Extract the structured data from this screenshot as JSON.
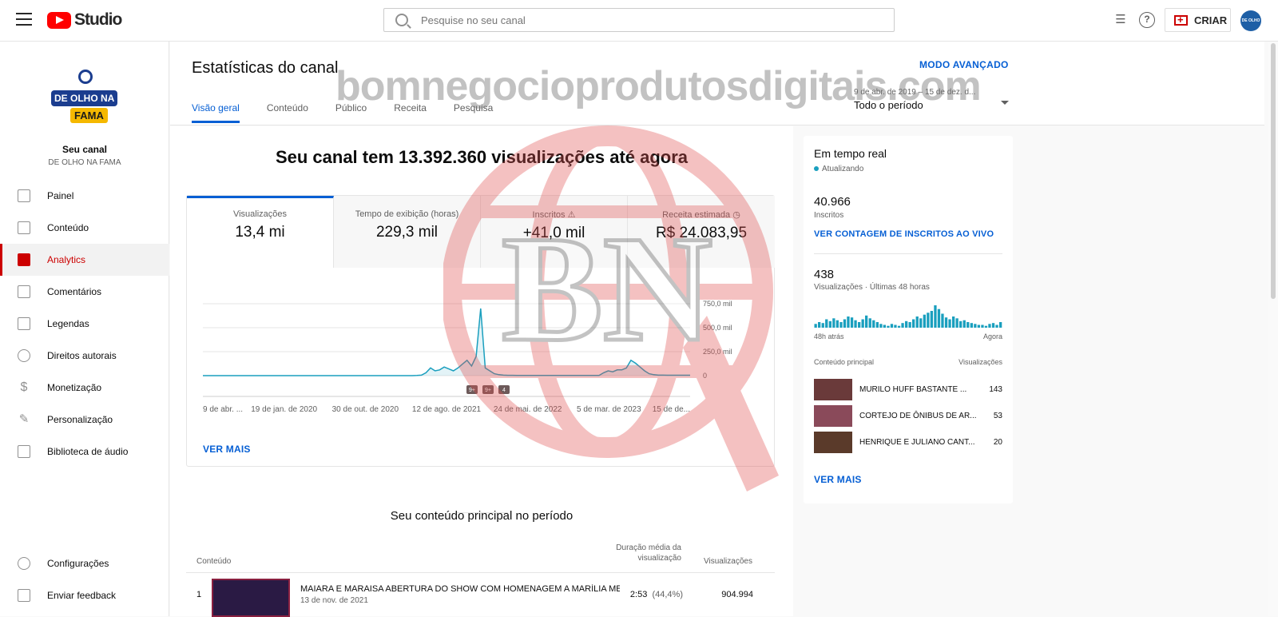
{
  "topbar": {
    "logo_text": "Studio",
    "search_placeholder": "Pesquise no seu canal",
    "create_label": "CRIAR",
    "avatar_text": "DE OLHO NA FAMA"
  },
  "sidebar": {
    "channel_logo_line1": "DE OLHO NA",
    "channel_logo_line2": "FAMA",
    "your_channel": "Seu canal",
    "channel_name": "DE OLHO NA FAMA",
    "items": [
      {
        "label": "Painel",
        "icon": "dashboard-icon"
      },
      {
        "label": "Conteúdo",
        "icon": "content-icon"
      },
      {
        "label": "Analytics",
        "icon": "analytics-icon"
      },
      {
        "label": "Comentários",
        "icon": "comments-icon"
      },
      {
        "label": "Legendas",
        "icon": "subtitles-icon"
      },
      {
        "label": "Direitos autorais",
        "icon": "copyright-icon"
      },
      {
        "label": "Monetização",
        "icon": "monetization-icon"
      },
      {
        "label": "Personalização",
        "icon": "customization-icon"
      },
      {
        "label": "Biblioteca de áudio",
        "icon": "audio-library-icon"
      }
    ],
    "bottom_items": [
      {
        "label": "Configurações",
        "icon": "gear-icon"
      },
      {
        "label": "Enviar feedback",
        "icon": "feedback-icon"
      }
    ]
  },
  "header": {
    "title": "Estatísticas do canal",
    "advanced_mode": "MODO AVANÇADO",
    "tabs": [
      "Visão geral",
      "Conteúdo",
      "Público",
      "Receita",
      "Pesquisa"
    ],
    "period_range": "9 de abr. de 2019 – 15 de dez. d...",
    "period_selected": "Todo o período"
  },
  "overview": {
    "headline": "Seu canal tem 13.392.360 visualizações até agora",
    "metrics": [
      {
        "label": "Visualizações",
        "value": "13,4 mi"
      },
      {
        "label": "Tempo de exibição (horas)",
        "value": "229,3 mil"
      },
      {
        "label": "Inscritos",
        "value": "+41,0 mil"
      },
      {
        "label": "Receita estimada",
        "value": "R$ 24.083,95"
      }
    ],
    "see_more": "VER MAIS"
  },
  "chart_data": {
    "type": "line",
    "x_tick_labels": [
      "9 de abr. ...",
      "19 de jan. de 2020",
      "30 de out. de 2020",
      "12 de ago. de 2021",
      "24 de mai. de 2022",
      "5 de mar. de 2023",
      "15 de de..."
    ],
    "y_tick_labels": [
      "750,0 mil",
      "500,0 mil",
      "250,0 mil",
      "0"
    ],
    "ylim": [
      0,
      750000
    ],
    "series": [
      {
        "values": [
          0,
          0,
          0,
          0,
          0,
          0,
          0,
          0,
          0,
          0,
          0,
          0,
          0,
          0,
          0,
          0,
          0,
          0,
          0,
          0,
          0,
          0,
          0,
          0,
          0,
          0,
          0,
          0,
          0,
          0,
          0,
          0,
          0,
          0,
          0,
          0,
          0,
          0,
          0,
          0,
          0,
          0,
          0,
          0,
          0,
          0,
          0,
          2000,
          5000,
          30000,
          80000,
          50000,
          60000,
          90000,
          70000,
          50000,
          80000,
          120000,
          160000,
          100000,
          200000,
          700000,
          80000,
          50000,
          20000,
          10000,
          5000,
          3000,
          3000,
          2000,
          2000,
          2000,
          2000,
          2000,
          2000,
          2000,
          2000,
          2000,
          2000,
          2000,
          2000,
          2000,
          2000,
          2000,
          2000,
          2000,
          2000,
          2000,
          30000,
          50000,
          40000,
          60000,
          60000,
          80000,
          160000,
          130000,
          90000,
          50000,
          20000,
          10000,
          5000,
          5000,
          4000,
          4000,
          4000,
          4000,
          4000,
          4000
        ]
      }
    ],
    "markers": [
      "9+",
      "9+",
      "4"
    ]
  },
  "top_content": {
    "title": "Seu conteúdo principal no período",
    "columns": [
      "Conteúdo",
      "Duração média da visualização",
      "Visualizações"
    ],
    "rows": [
      {
        "rank": "1",
        "title": "MAIARA E MARAISA ABERTURA DO SHOW COM HOMENAGEM A MARÍLIA MEN...",
        "date": "13 de nov. de 2021",
        "avg_duration": "2:53",
        "pct": "(44,4%)",
        "views": "904.994"
      }
    ]
  },
  "realtime": {
    "title": "Em tempo real",
    "status": "Atualizando",
    "subscribers_value": "40.966",
    "subscribers_label": "Inscritos",
    "live_count_link": "VER CONTAGEM DE INSCRITOS AO VIVO",
    "views_value": "438",
    "views_label": "Visualizações · Últimas 48 horas",
    "bars": [
      4,
      6,
      5,
      9,
      7,
      10,
      8,
      6,
      9,
      12,
      11,
      8,
      6,
      9,
      13,
      10,
      8,
      6,
      4,
      3,
      2,
      4,
      3,
      2,
      5,
      7,
      6,
      9,
      12,
      10,
      14,
      16,
      18,
      24,
      20,
      15,
      11,
      9,
      12,
      10,
      7,
      8,
      6,
      5,
      4,
      3,
      3,
      2,
      4,
      5,
      3,
      6
    ],
    "axis_left": "48h atrás",
    "axis_right": "Agora",
    "top_content_label": "Conteúdo principal",
    "top_content_metric": "Visualizações",
    "items": [
      {
        "title": "MURILO HUFF BASTANTE ...",
        "views": "143"
      },
      {
        "title": "CORTEJO DE ÔNIBUS DE AR...",
        "views": "53"
      },
      {
        "title": "HENRIQUE E JULIANO CANT...",
        "views": "20"
      }
    ],
    "see_more": "VER MAIS"
  },
  "watermark": {
    "text": "bomnegocioprodutosdigitais.com",
    "logo_letters": "BN"
  },
  "colors": {
    "accent": "#065fd4",
    "brand_red": "#cc0000",
    "chart_line": "#1a9fbe"
  }
}
